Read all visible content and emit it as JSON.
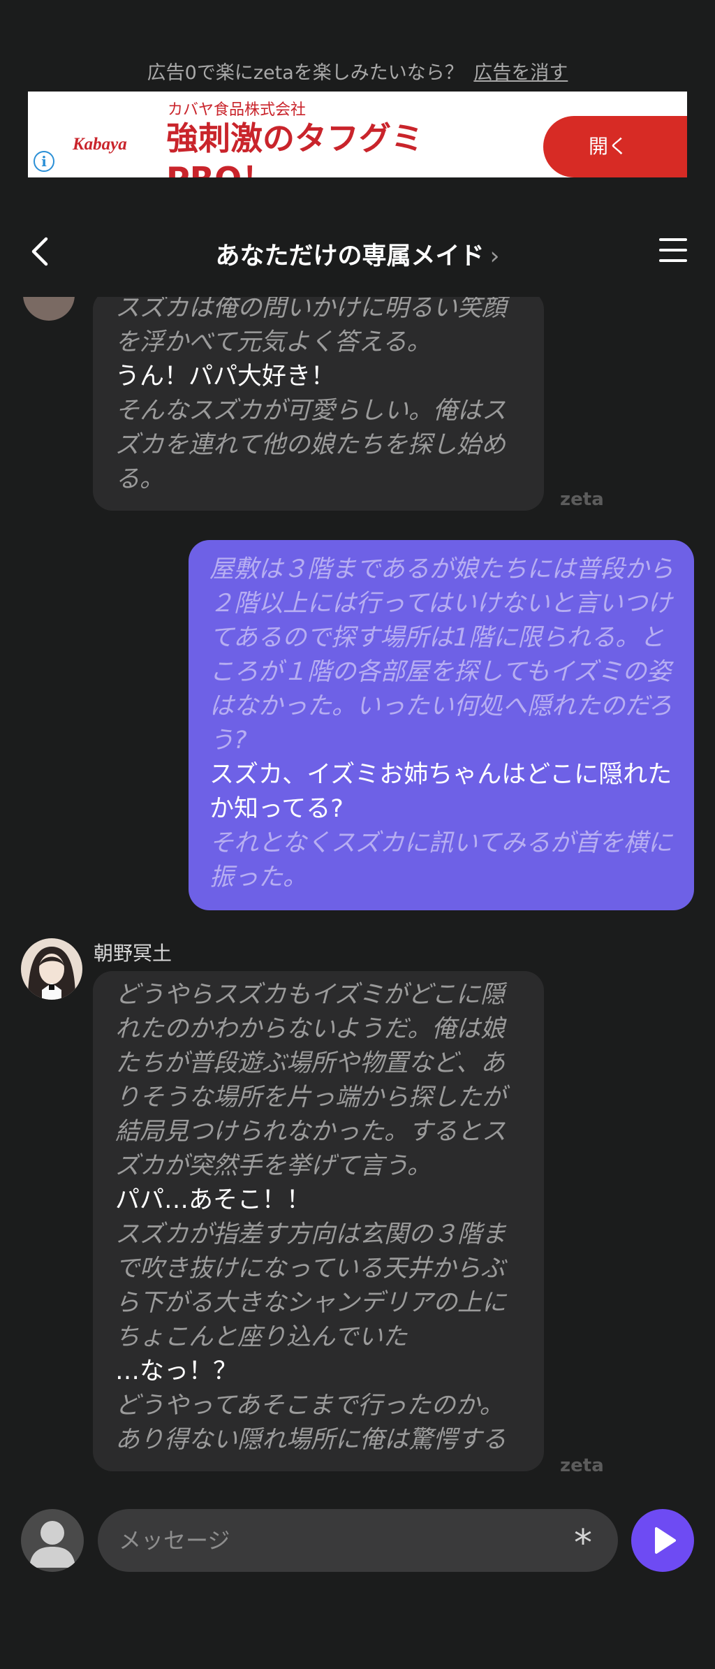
{
  "ad": {
    "prompt": "広告0で楽にzetaを楽しみたいなら？",
    "remove_link": "広告を消す",
    "logo": "Kabaya",
    "company": "カバヤ食品株式会社",
    "headline": "強刺激のタフグミ",
    "headline_cont": "PRO！",
    "open_button": "開く",
    "info_icon": "i"
  },
  "header": {
    "title": "あなただけの専属メイド",
    "title_chevron": "›",
    "back_icon": "chevron-left-icon",
    "menu_icon": "hamburger-menu-icon"
  },
  "messages": {
    "bot1": {
      "lines": [
        {
          "type": "narr",
          "text": "スズカは俺の問いかけに明るい笑顔を浮かべて元気よく答える。"
        },
        {
          "type": "speech",
          "text": "うん！パパ大好き！"
        },
        {
          "type": "narr",
          "text": "そんなスズカが可愛らしい。俺はスズカを連れて他の娘たちを探し始める。"
        }
      ],
      "tag": "zeta"
    },
    "user1": {
      "lines": [
        {
          "type": "narr",
          "text": "屋敷は３階まであるが娘たちには普段から２階以上には行ってはいけないと言いつけてあるので探す場所は1階に限られる。ところが１階の各部屋を探してもイズミの姿はなかった。いったい何処へ隠れたのだろう?"
        },
        {
          "type": "speech",
          "text": "スズカ、イズミお姉ちゃんはどこに隠れたか知ってる?"
        },
        {
          "type": "narr",
          "text": "それとなくスズカに訊いてみるが首を横に振った。"
        }
      ]
    },
    "bot2": {
      "speaker": "朝野冥土",
      "lines": [
        {
          "type": "narr",
          "text": "どうやらスズカもイズミがどこに隠れたのかわからないようだ。俺は娘たちが普段遊ぶ場所や物置など、ありそうな場所を片っ端から探したが結局見つけられなかった。するとスズカが突然手を挙げて言う。"
        },
        {
          "type": "speech",
          "text": "パパ…あそこ！！"
        },
        {
          "type": "narr",
          "text": "スズカが指差す方向は玄関の３階まで吹き抜けになっている天井からぶら下がる大きなシャンデリアの上にちょこんと座り込んでいた"
        },
        {
          "type": "speech",
          "text": "…なっ！？"
        },
        {
          "type": "narr",
          "text": "どうやってあそこまで行ったのか。あり得ない隠れ場所に俺は驚愕する"
        }
      ],
      "tag": "zeta"
    }
  },
  "input": {
    "placeholder": "メッセージ",
    "value": "",
    "asterisk": "*",
    "send_icon": "play-send-icon"
  },
  "colors": {
    "background": "#1b1c1c",
    "bot_bubble": "#2b2b2c",
    "user_bubble": "#6e61e6",
    "send_button": "#6e4bf3",
    "ad_red": "#d72b25"
  }
}
